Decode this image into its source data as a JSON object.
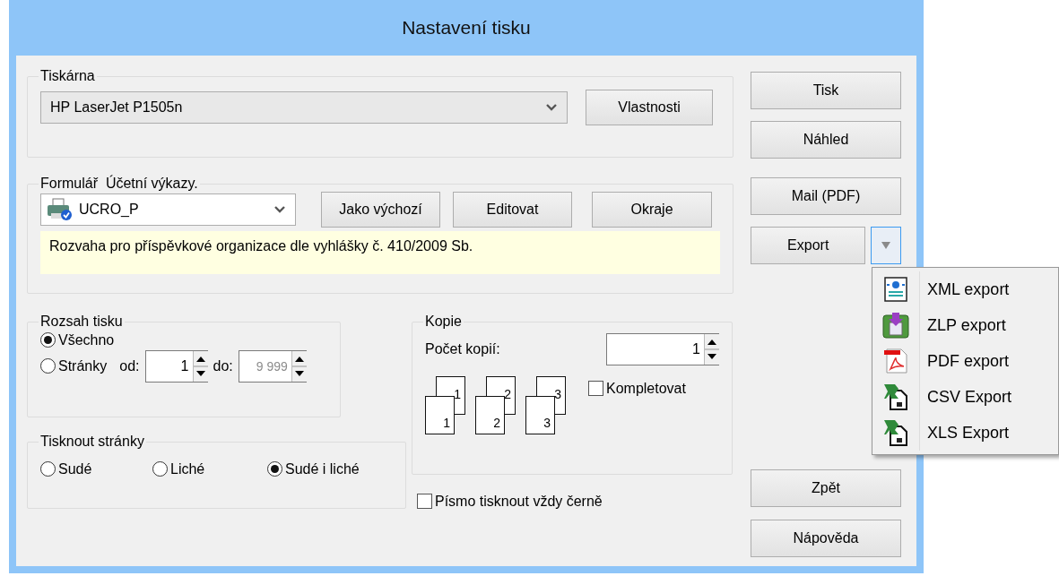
{
  "window": {
    "title": "Nastavení tisku"
  },
  "printer": {
    "legend": "Tiskárna",
    "device": "HP LaserJet P1505n",
    "properties_button": "Vlastnosti"
  },
  "form": {
    "legend": "Formulář  Účetní výkazy.",
    "template": "UCRO_P",
    "buttons": [
      "Jako výchozí",
      "Editovat",
      "Okraje"
    ],
    "description": "Rozvaha pro příspěvkové organizace dle vyhlášky č. 410/2009 Sb."
  },
  "page_range": {
    "legend": "Rozsah tisku",
    "options": [
      {
        "label": "Všechno",
        "selected": true
      },
      {
        "label": "Stránky",
        "selected": false
      }
    ],
    "from": {
      "label": "od:",
      "value": "1",
      "disabled": false
    },
    "to": {
      "label": "do:",
      "value": "9 999",
      "disabled": true
    }
  },
  "print_pages": {
    "legend": "Tisknout stránky",
    "options": [
      {
        "label": "Sudé",
        "selected": false
      },
      {
        "label": "Liché",
        "selected": false
      },
      {
        "label": "Sudé i liché",
        "selected": true
      }
    ]
  },
  "copies": {
    "legend": "Kopie",
    "count_label": "Počet kopií:",
    "count": "1",
    "collate_pages": [
      [
        "1",
        "1"
      ],
      [
        "2",
        "2"
      ],
      [
        "3",
        "3"
      ]
    ],
    "collate": {
      "label": "Kompletovat",
      "checked": false
    }
  },
  "black_text": {
    "label": "Písmo tisknout vždy černě",
    "checked": false
  },
  "actions": {
    "top": [
      "Tisk",
      "Náhled"
    ],
    "mail": "Mail (PDF)",
    "export": "Export",
    "bottom": [
      "Zpět",
      "Nápověda"
    ]
  },
  "export_menu": {
    "open": true,
    "items": [
      {
        "label": "XML export"
      },
      {
        "label": "ZLP export"
      },
      {
        "label": "PDF export"
      },
      {
        "label": "CSV Export"
      },
      {
        "label": "XLS Export"
      }
    ]
  }
}
